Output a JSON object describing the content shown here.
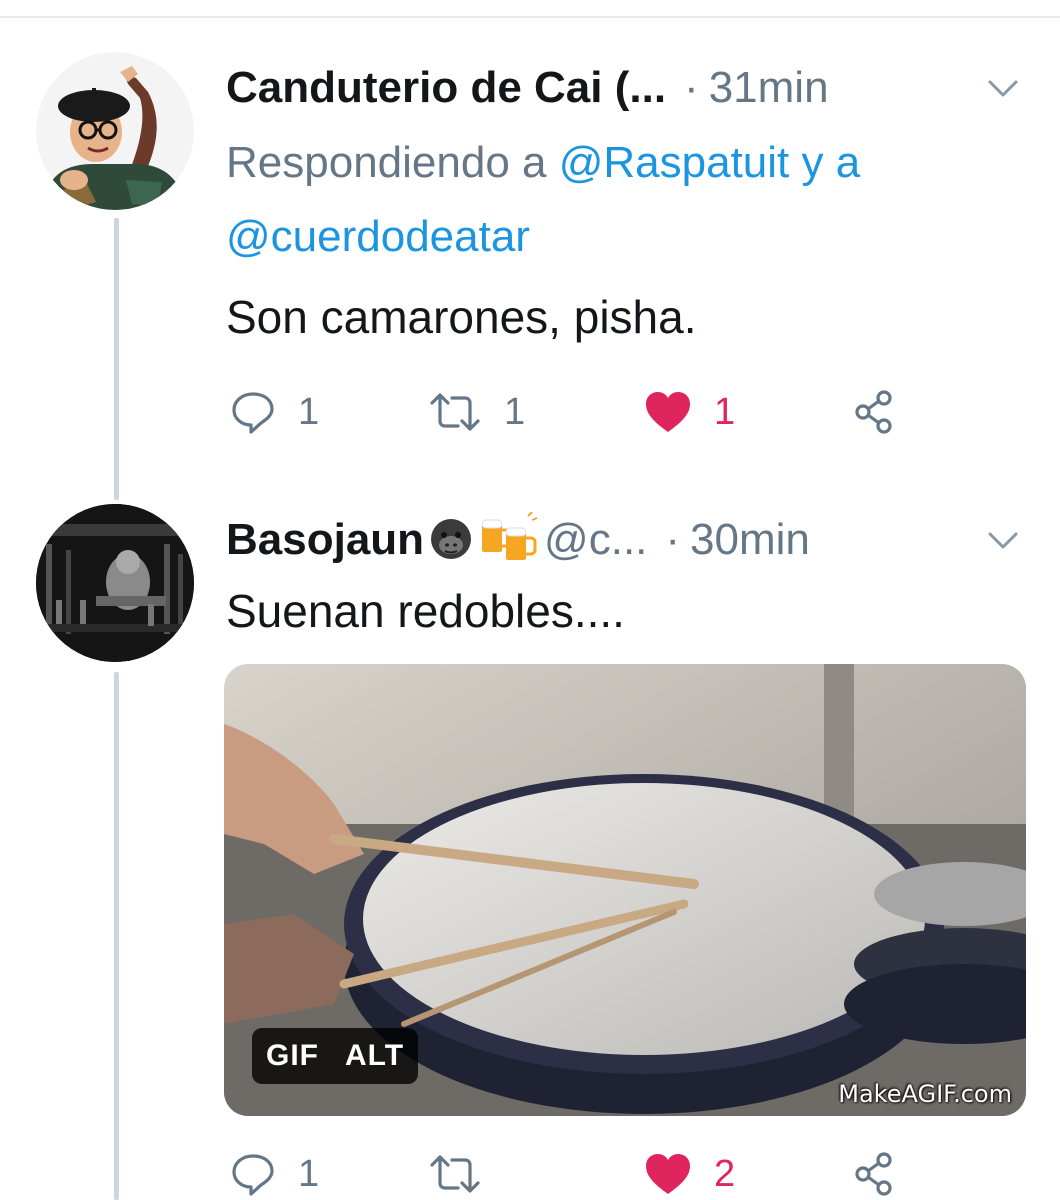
{
  "tweets": [
    {
      "display_name": "Canduterio de Cai (...",
      "separator": "·",
      "time": "31min",
      "reply_to_prefix": "Respondiendo a",
      "reply_to_users": [
        "@Raspatuit",
        "@cuerdodeatar"
      ],
      "reply_to_joiner": "y a",
      "text": "Son camarones, pisha.",
      "stats": {
        "replies": "1",
        "retweets": "1",
        "likes": "1",
        "liked": true
      }
    },
    {
      "display_name": "Basojaun",
      "name_emojis": [
        "gorilla-emoji",
        "beer-mugs-emoji"
      ],
      "handle": "@c...",
      "separator": "·",
      "time": "30min",
      "text": "Suenan redobles....",
      "media": {
        "badge_gif": "GIF",
        "badge_alt": "ALT",
        "watermark": "MakeAGIF.com"
      },
      "stats": {
        "replies": "1",
        "retweets": "",
        "likes": "2",
        "liked": true
      }
    }
  ],
  "colors": {
    "text": "#14171a",
    "secondary": "#657786",
    "link": "#1b95e0",
    "like": "#e0245e",
    "thread_line": "#ccd6dd"
  }
}
